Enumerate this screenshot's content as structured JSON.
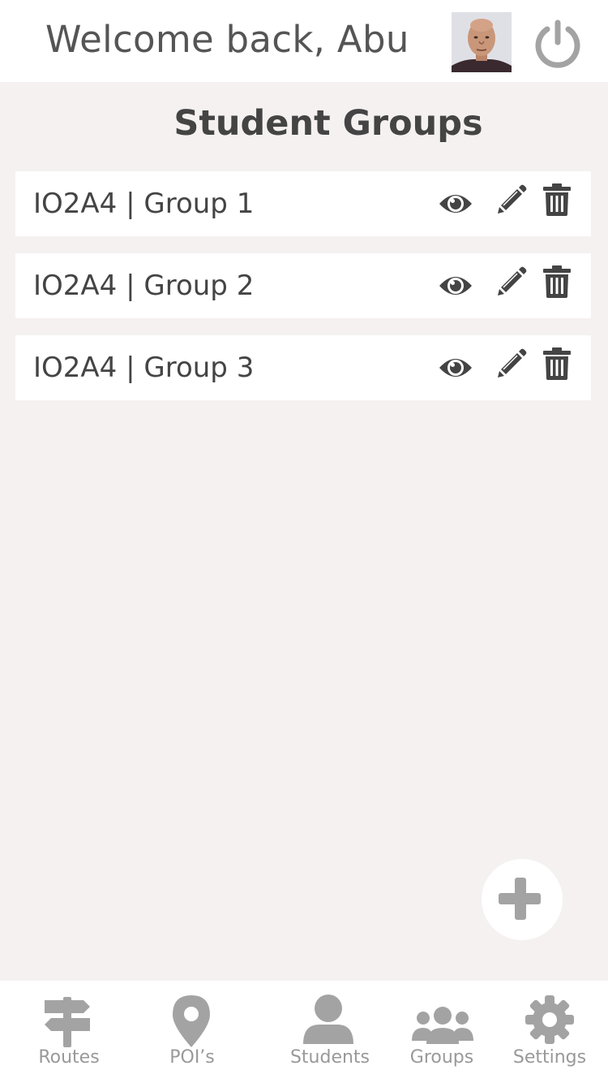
{
  "header": {
    "welcome_text": "Welcome back, Abu"
  },
  "page": {
    "title": "Student Groups"
  },
  "groups": [
    {
      "name": "IO2A4 | Group 1"
    },
    {
      "name": "IO2A4 | Group 2"
    },
    {
      "name": "IO2A4 | Group 3"
    }
  ],
  "nav": {
    "items": [
      {
        "label": "Routes",
        "icon": "signpost-icon"
      },
      {
        "label": "POI’s",
        "icon": "map-pin-icon"
      },
      {
        "label": "Students",
        "icon": "user-icon"
      },
      {
        "label": "Groups",
        "icon": "group-icon"
      },
      {
        "label": "Settings",
        "icon": "gear-icon"
      }
    ]
  },
  "colors": {
    "background": "#f5f1f0",
    "surface": "#ffffff",
    "text_dark": "#444444",
    "icon_gray": "#a3a3a3",
    "nav_label": "#999999"
  }
}
